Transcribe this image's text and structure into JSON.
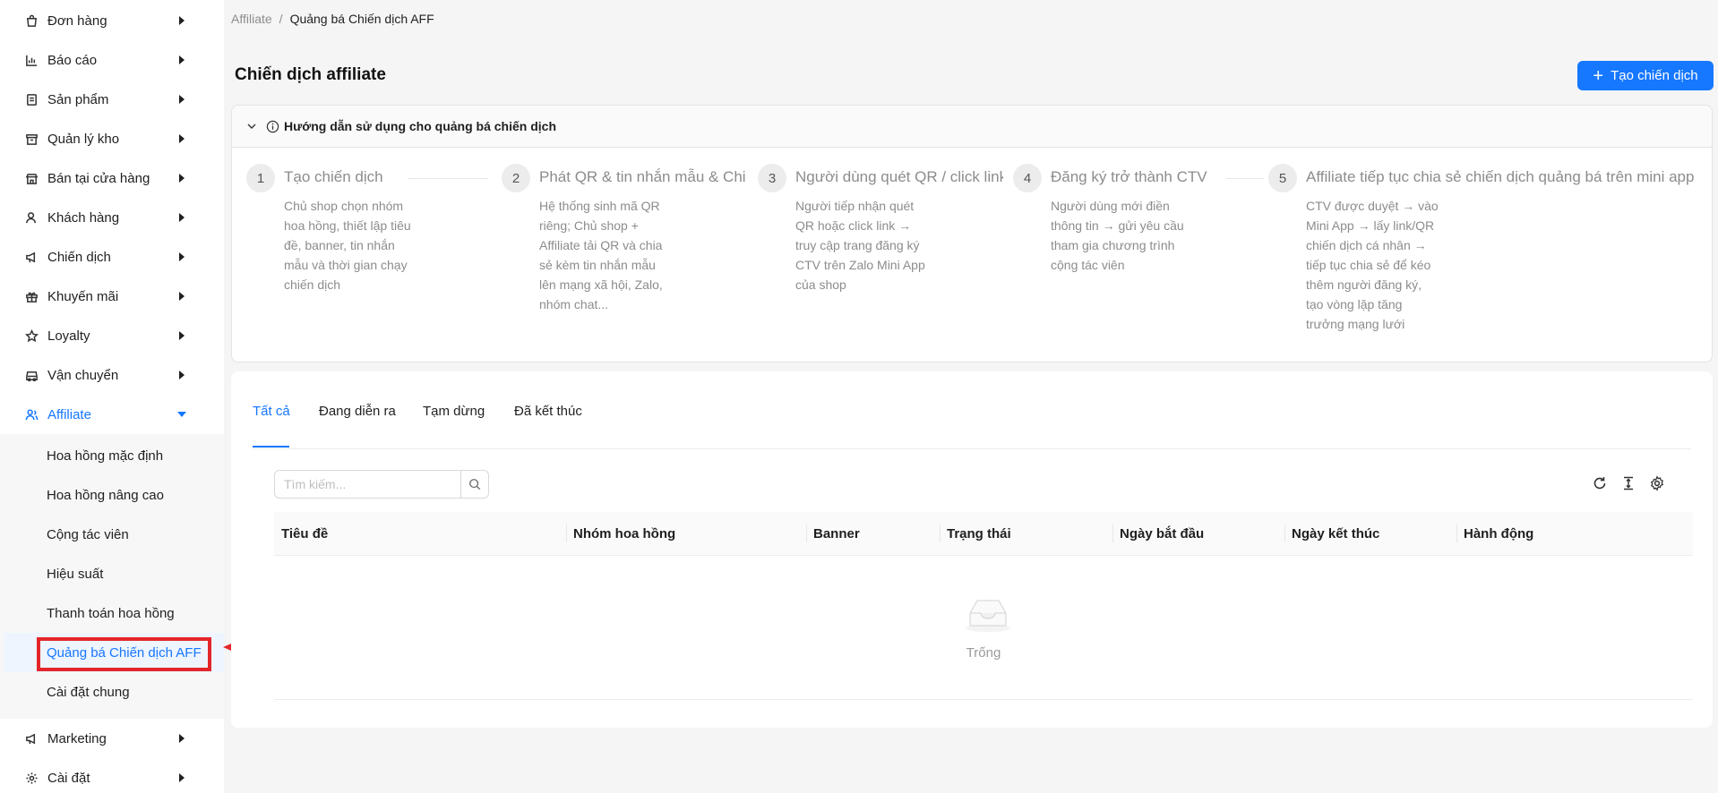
{
  "sidebar": {
    "items": [
      {
        "label": "Đơn hàng",
        "icon": "bag-icon"
      },
      {
        "label": "Báo cáo",
        "icon": "bar-chart-icon"
      },
      {
        "label": "Sản phẩm",
        "icon": "product-icon"
      },
      {
        "label": "Quản lý kho",
        "icon": "warehouse-icon"
      },
      {
        "label": "Bán tại cửa hàng",
        "icon": "store-icon"
      },
      {
        "label": "Khách hàng",
        "icon": "customer-icon"
      },
      {
        "label": "Chiến dịch",
        "icon": "megaphone-icon"
      },
      {
        "label": "Khuyến mãi",
        "icon": "gift-icon"
      },
      {
        "label": "Loyalty",
        "icon": "star-icon"
      },
      {
        "label": "Vận chuyển",
        "icon": "truck-icon"
      },
      {
        "label": "Affiliate",
        "icon": "affiliate-icon"
      }
    ],
    "affiliate_sub": [
      {
        "label": "Hoa hồng mặc định"
      },
      {
        "label": "Hoa hồng nâng cao"
      },
      {
        "label": "Cộng tác viên"
      },
      {
        "label": "Hiệu suất"
      },
      {
        "label": "Thanh toán hoa hồng"
      },
      {
        "label": "Quảng bá Chiến dịch AFF"
      },
      {
        "label": "Cài đặt chung"
      }
    ],
    "bottom_items": [
      {
        "label": "Marketing",
        "icon": "megaphone-icon"
      },
      {
        "label": "Cài đặt",
        "icon": "gear-icon"
      }
    ]
  },
  "breadcrumb": {
    "parent": "Affiliate",
    "separator": "/",
    "current": "Quảng bá Chiến dịch AFF"
  },
  "page": {
    "title": "Chiến dịch affiliate",
    "create_button": "Tạo chiến dịch"
  },
  "guide": {
    "title": "Hướng dẫn sử dụng cho quảng bá chiến dịch",
    "steps": [
      {
        "num": "1",
        "title": "Tạo chiến dịch",
        "desc": "Chủ shop chọn nhóm hoa hồng, thiết lập tiêu đề, banner, tin nhắn mẫu và thời gian chạy chiến dịch"
      },
      {
        "num": "2",
        "title": "Phát QR & tin nhắn mẫu & Chia sẻ",
        "desc": "Hệ thống sinh mã QR riêng; Chủ shop + Affiliate tải QR và chia sẻ kèm tin nhắn mẫu lên mạng xã hội, Zalo, nhóm chat..."
      },
      {
        "num": "3",
        "title": "Người dùng quét QR / click link",
        "desc": "Người tiếp nhận quét QR hoặc click link → truy cập trang đăng ký CTV trên Zalo Mini App của shop"
      },
      {
        "num": "4",
        "title": "Đăng ký trở thành CTV",
        "desc": "Người dùng mới điền thông tin → gửi yêu cầu tham gia chương trình cộng tác viên"
      },
      {
        "num": "5",
        "title": "Affiliate tiếp tục chia sẻ chiến dịch quảng bá trên mini app",
        "desc": "CTV được duyệt → vào Mini App → lấy link/QR chiến dịch cá nhân → tiếp tục chia sẻ để kéo thêm người đăng ký, tạo vòng lặp tăng trưởng mạng lưới"
      }
    ]
  },
  "tabs": [
    {
      "label": "Tất cả"
    },
    {
      "label": "Đang diễn ra"
    },
    {
      "label": "Tạm dừng"
    },
    {
      "label": "Đã kết thúc"
    }
  ],
  "search": {
    "placeholder": "Tìm kiếm...",
    "value": ""
  },
  "table": {
    "columns": [
      "Tiêu đề",
      "Nhóm hoa hồng",
      "Banner",
      "Trạng thái",
      "Ngày bắt đầu",
      "Ngày kết thúc",
      "Hành động"
    ],
    "empty_text": "Trống"
  },
  "colors": {
    "accent": "#1677ff",
    "highlight": "#e3262b"
  }
}
